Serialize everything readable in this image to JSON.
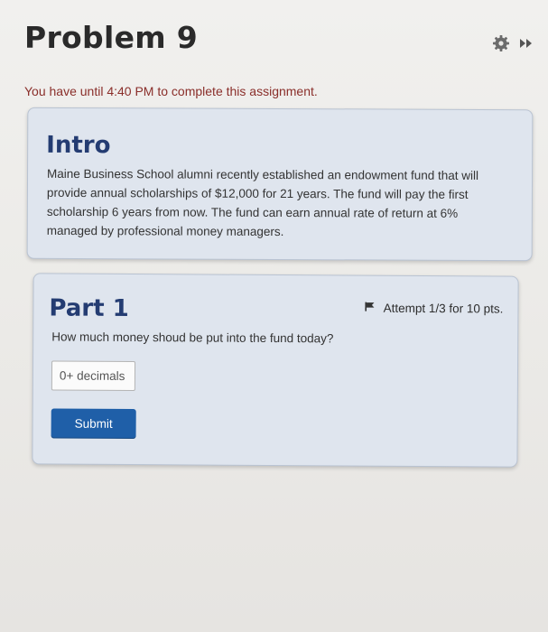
{
  "page": {
    "title": "Problem 9",
    "deadline_text": "You have until 4:40 PM to complete this assignment."
  },
  "top_icons": [
    {
      "name": "gear-icon"
    },
    {
      "name": "fast-forward-icon"
    }
  ],
  "intro": {
    "heading": "Intro",
    "body": "Maine Business School alumni recently established an endowment fund that will provide annual scholarships of $12,000 for 21 years. The fund will pay the first scholarship 6 years from now. The fund can earn annual rate of return at 6% managed by professional money managers."
  },
  "part1": {
    "heading": "Part 1",
    "attempt_text": "Attempt 1/3 for 10 pts.",
    "question": "How much money shoud be put into the fund today?",
    "input": {
      "value": "",
      "placeholder": "0+ decimals"
    },
    "submit_label": "Submit"
  },
  "colors": {
    "heading_blue": "#243c72",
    "card_background": "#dfe5ee",
    "submit_blue": "#1f5fa8",
    "deadline_red": "#8a2e2a"
  }
}
